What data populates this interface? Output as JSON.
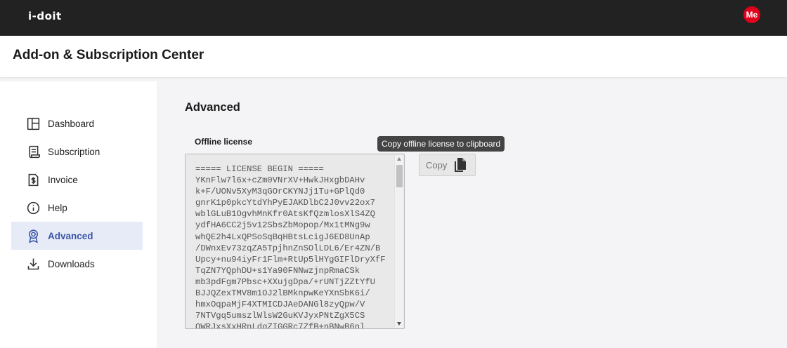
{
  "topbar": {
    "logo": "i-doit",
    "avatar": "Me"
  },
  "header": {
    "title": "Add-on & Subscription Center"
  },
  "sidebar": {
    "items": [
      {
        "label": "Dashboard",
        "icon": "dashboard-icon"
      },
      {
        "label": "Subscription",
        "icon": "receipt-icon"
      },
      {
        "label": "Invoice",
        "icon": "invoice-icon"
      },
      {
        "label": "Help",
        "icon": "info-icon"
      },
      {
        "label": "Advanced",
        "icon": "award-icon",
        "active": true
      },
      {
        "label": "Downloads",
        "icon": "download-icon"
      }
    ]
  },
  "main": {
    "section_title": "Advanced",
    "license_label": "Offline license",
    "license_text": "===== LICENSE BEGIN =====\nYKnFlw7l6x+cZm0VNrXV+HwkJHxgbDAHv\nk+F/UONv5XyM3qGOrCKYNJj1Tu+GPlQd0\ngnrK1p0pkcYtdYhPyEJAKDlbC2J0vv22ox7\nwblGLuB1OgvhMnKfr0AtsKfQzmlosXlS4ZQ\nydfHA6CC2j5v12SbsZbMopop/Mx1tMNg9w\nwhQE2h4LxQPSoSqBqHBtsLcigJ6ED8UnAp\n/DWnxEv73zqZA5TpjhnZnSOlLDL6/Er4ZN/B\nUpcy+nu94iyFr1Flm+RtUp5lHYgGIFlDryXfF\nTqZN7YQphDU+s1Ya90FNNwzjnpRmaCSk\nmb3pdFgm7Pbsc+XXujgDpa/+rUNTjZZtYfU\nBJJQZexTMV8m1OJ2lBMknpwKeYXnSbK6i/\nhmxOqpaMjF4XTMICDJAeDANGl8zyQpw/V\n7NTVgq5umszlWlsW2GuKVJyxPNtZgX5CS\nQWRJxsXxHRnLdqZIGGRc7ZfB+nBNwB6nl",
    "copy_label": "Copy",
    "tooltip": "Copy offline license to clipboard"
  },
  "colors": {
    "topbar": "#222222",
    "avatar": "#e0001b",
    "active_nav_bg": "#e6ebf7",
    "active_nav_text": "#3a55a8"
  }
}
